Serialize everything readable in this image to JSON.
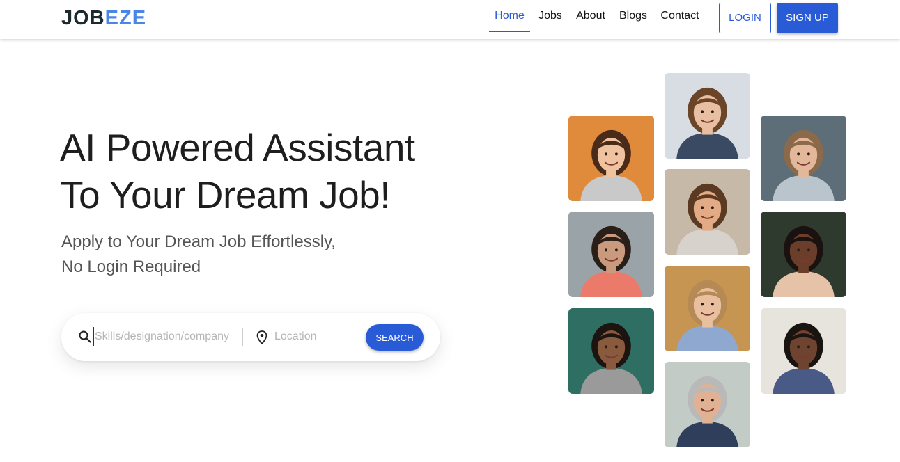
{
  "brand": {
    "part1": "JOB",
    "part2": "EZE",
    "color_dark": "#1b2b2f",
    "color_accent": "#4a86e8"
  },
  "nav": {
    "links": [
      {
        "label": "Home",
        "active": true
      },
      {
        "label": "Jobs",
        "active": false
      },
      {
        "label": "About",
        "active": false
      },
      {
        "label": "Blogs",
        "active": false
      },
      {
        "label": "Contact",
        "active": false
      }
    ],
    "login_label": "LOGIN",
    "signup_label": "SIGN UP"
  },
  "hero": {
    "title_line1": "AI Powered Assistant",
    "title_line2": "To Your Dream Job!",
    "subtitle_line1": "Apply to Your Dream Job Effortlessly,",
    "subtitle_line2": "No Login Required"
  },
  "search": {
    "keyword_placeholder": "Skills/designation/company",
    "location_placeholder": "Location",
    "button_label": "SEARCH",
    "search_icon": "search-icon",
    "location_icon": "location-pin-icon"
  },
  "theme": {
    "primary": "#2a5bd7"
  },
  "photos": [
    {
      "name": "woman-smiling-orange-bg",
      "bg": "#e08a3c",
      "skin": "#f0c3a0",
      "hair": "#4a2a18",
      "shirt": "#c9c9c9"
    },
    {
      "name": "woman-long-hair-coral-top",
      "bg": "#9aa3a8",
      "skin": "#c99a7e",
      "hair": "#2a1e18",
      "shirt": "#ec7a6a"
    },
    {
      "name": "woman-curly-hair-gray-sweater",
      "bg": "#2f6e63",
      "skin": "#8a5a3e",
      "hair": "#1c1410",
      "shirt": "#9a9a9a"
    },
    {
      "name": "woman-wavy-hair-smiling",
      "bg": "#d7dde2",
      "skin": "#e9bfa3",
      "hair": "#6a4528",
      "shirt": "#3b4a63"
    },
    {
      "name": "man-on-phone-beard",
      "bg": "#c7b9a8",
      "skin": "#e2aa85",
      "hair": "#5a3a22",
      "shirt": "#d7d3cc"
    },
    {
      "name": "woman-blonde-blue-shirt",
      "bg": "#c79552",
      "skin": "#e8c0a0",
      "hair": "#b58a55",
      "shirt": "#8fa8d0"
    },
    {
      "name": "man-glasses-suit-phone",
      "bg": "#c3cbc7",
      "skin": "#e0b293",
      "hair": "#b9b9b9",
      "shirt": "#2f3e5a"
    },
    {
      "name": "man-headphones-phone",
      "bg": "#5d6e78",
      "skin": "#e3b79a",
      "hair": "#8a6a4a",
      "shirt": "#b9c4cc"
    },
    {
      "name": "woman-curly-hair-phone",
      "bg": "#2e3a2e",
      "skin": "#6a3e2a",
      "hair": "#1a1210",
      "shirt": "#e6c2a8"
    },
    {
      "name": "man-laptop-smiling",
      "bg": "#e7e4de",
      "skin": "#6e4430",
      "hair": "#1a1410",
      "shirt": "#4a5a86"
    }
  ]
}
